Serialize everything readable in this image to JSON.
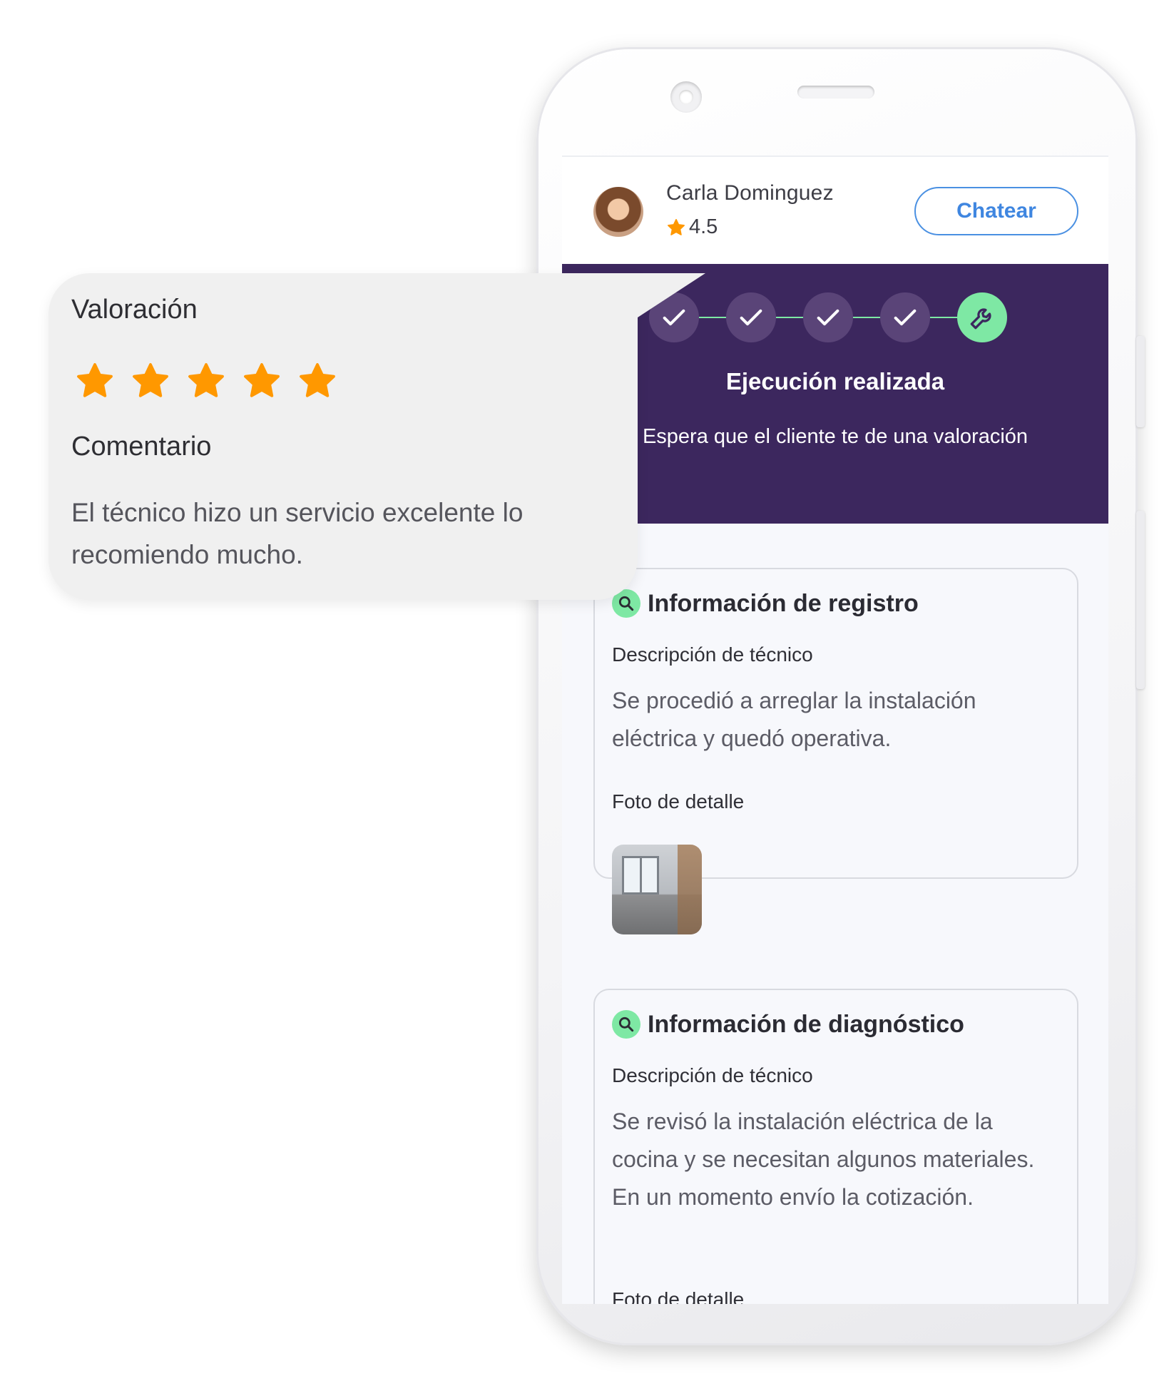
{
  "technician": {
    "name": "Carla Dominguez",
    "rating": "4.5",
    "chat_label": "Chatear"
  },
  "progress": {
    "title": "Ejecución realizada",
    "subtitle": "Espera que el cliente te de una valoración",
    "steps_completed": 4,
    "steps_total": 5,
    "active_step_icon": "wrench-icon"
  },
  "cards": [
    {
      "title": "Información de registro",
      "description_label": "Descripción de técnico",
      "description": "Se procedió a arreglar la instalación eléctrica y quedó operativa.",
      "photo_label": "Foto de detalle"
    },
    {
      "title": "Información de diagnóstico",
      "description_label": "Descripción de técnico",
      "description": "Se revisó la instalación eléctrica de la cocina y se necesitan algunos materiales. En un momento envío la cotización.",
      "photo_label": "Foto de detalle"
    }
  ],
  "review": {
    "rating_label": "Valoración",
    "stars": 5,
    "stars_max": 5,
    "comment_label": "Comentario",
    "comment": "El técnico hizo un servicio excelente lo recomiendo mucho."
  },
  "colors": {
    "band": "#3c275e",
    "accent_green": "#7ee8a4",
    "chat_blue": "#4a90e2",
    "star_orange": "#ff9800"
  }
}
